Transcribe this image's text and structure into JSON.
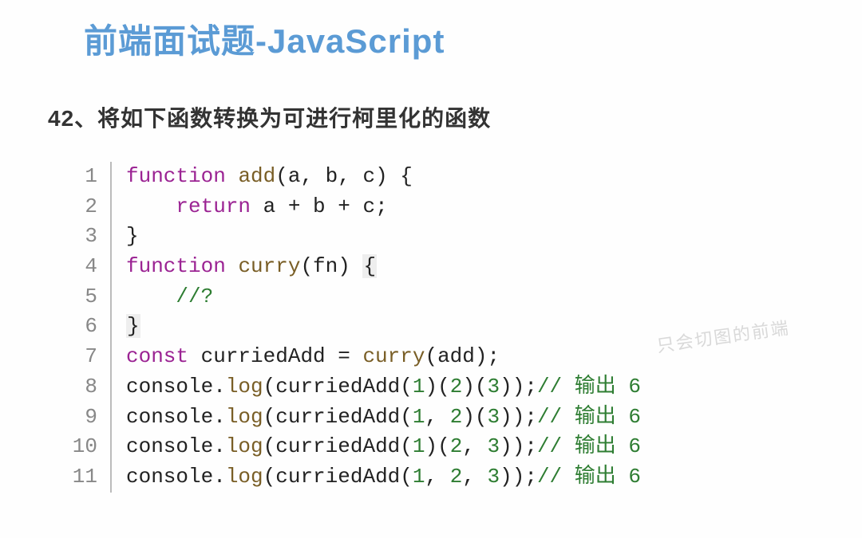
{
  "title": "前端面试题-JavaScript",
  "question": "42、将如下函数转换为可进行柯里化的函数",
  "watermark": "只会切图的前端",
  "code": {
    "lines": [
      {
        "n": "1",
        "segs": [
          {
            "cls": "kw",
            "t": "function"
          },
          {
            "cls": "",
            "t": " "
          },
          {
            "cls": "fn",
            "t": "add"
          },
          {
            "cls": "",
            "t": "(a, b, c) {"
          }
        ]
      },
      {
        "n": "2",
        "segs": [
          {
            "cls": "",
            "t": "    "
          },
          {
            "cls": "kw",
            "t": "return"
          },
          {
            "cls": "",
            "t": " a + b + c;"
          }
        ]
      },
      {
        "n": "3",
        "segs": [
          {
            "cls": "",
            "t": "}"
          }
        ]
      },
      {
        "n": "4",
        "segs": [
          {
            "cls": "kw",
            "t": "function"
          },
          {
            "cls": "",
            "t": " "
          },
          {
            "cls": "fn",
            "t": "curry"
          },
          {
            "cls": "",
            "t": "(fn) "
          },
          {
            "cls": "cursor-box",
            "t": "{"
          }
        ]
      },
      {
        "n": "5",
        "segs": [
          {
            "cls": "",
            "t": "    "
          },
          {
            "cls": "comment",
            "t": "//?"
          }
        ]
      },
      {
        "n": "6",
        "segs": [
          {
            "cls": "cursor-box",
            "t": "}"
          }
        ]
      },
      {
        "n": "7",
        "segs": [
          {
            "cls": "kw",
            "t": "const"
          },
          {
            "cls": "",
            "t": " curriedAdd = "
          },
          {
            "cls": "fn",
            "t": "curry"
          },
          {
            "cls": "",
            "t": "(add);"
          }
        ]
      },
      {
        "n": "8",
        "segs": [
          {
            "cls": "",
            "t": "console."
          },
          {
            "cls": "fn",
            "t": "log"
          },
          {
            "cls": "",
            "t": "(curriedAdd("
          },
          {
            "cls": "num",
            "t": "1"
          },
          {
            "cls": "",
            "t": ")("
          },
          {
            "cls": "num",
            "t": "2"
          },
          {
            "cls": "",
            "t": ")("
          },
          {
            "cls": "num",
            "t": "3"
          },
          {
            "cls": "",
            "t": "));"
          },
          {
            "cls": "comment",
            "t": "// 输出 6"
          }
        ]
      },
      {
        "n": "9",
        "segs": [
          {
            "cls": "",
            "t": "console."
          },
          {
            "cls": "fn",
            "t": "log"
          },
          {
            "cls": "",
            "t": "(curriedAdd("
          },
          {
            "cls": "num",
            "t": "1"
          },
          {
            "cls": "",
            "t": ", "
          },
          {
            "cls": "num",
            "t": "2"
          },
          {
            "cls": "",
            "t": ")("
          },
          {
            "cls": "num",
            "t": "3"
          },
          {
            "cls": "",
            "t": "));"
          },
          {
            "cls": "comment",
            "t": "// 输出 6"
          }
        ]
      },
      {
        "n": "10",
        "segs": [
          {
            "cls": "",
            "t": "console."
          },
          {
            "cls": "fn",
            "t": "log"
          },
          {
            "cls": "",
            "t": "(curriedAdd("
          },
          {
            "cls": "num",
            "t": "1"
          },
          {
            "cls": "",
            "t": ")("
          },
          {
            "cls": "num",
            "t": "2"
          },
          {
            "cls": "",
            "t": ", "
          },
          {
            "cls": "num",
            "t": "3"
          },
          {
            "cls": "",
            "t": "));"
          },
          {
            "cls": "comment",
            "t": "// 输出 6"
          }
        ]
      },
      {
        "n": "11",
        "segs": [
          {
            "cls": "",
            "t": "console."
          },
          {
            "cls": "fn",
            "t": "log"
          },
          {
            "cls": "",
            "t": "(curriedAdd("
          },
          {
            "cls": "num",
            "t": "1"
          },
          {
            "cls": "",
            "t": ", "
          },
          {
            "cls": "num",
            "t": "2"
          },
          {
            "cls": "",
            "t": ", "
          },
          {
            "cls": "num",
            "t": "3"
          },
          {
            "cls": "",
            "t": "));"
          },
          {
            "cls": "comment",
            "t": "// 输出 6"
          }
        ]
      }
    ]
  }
}
